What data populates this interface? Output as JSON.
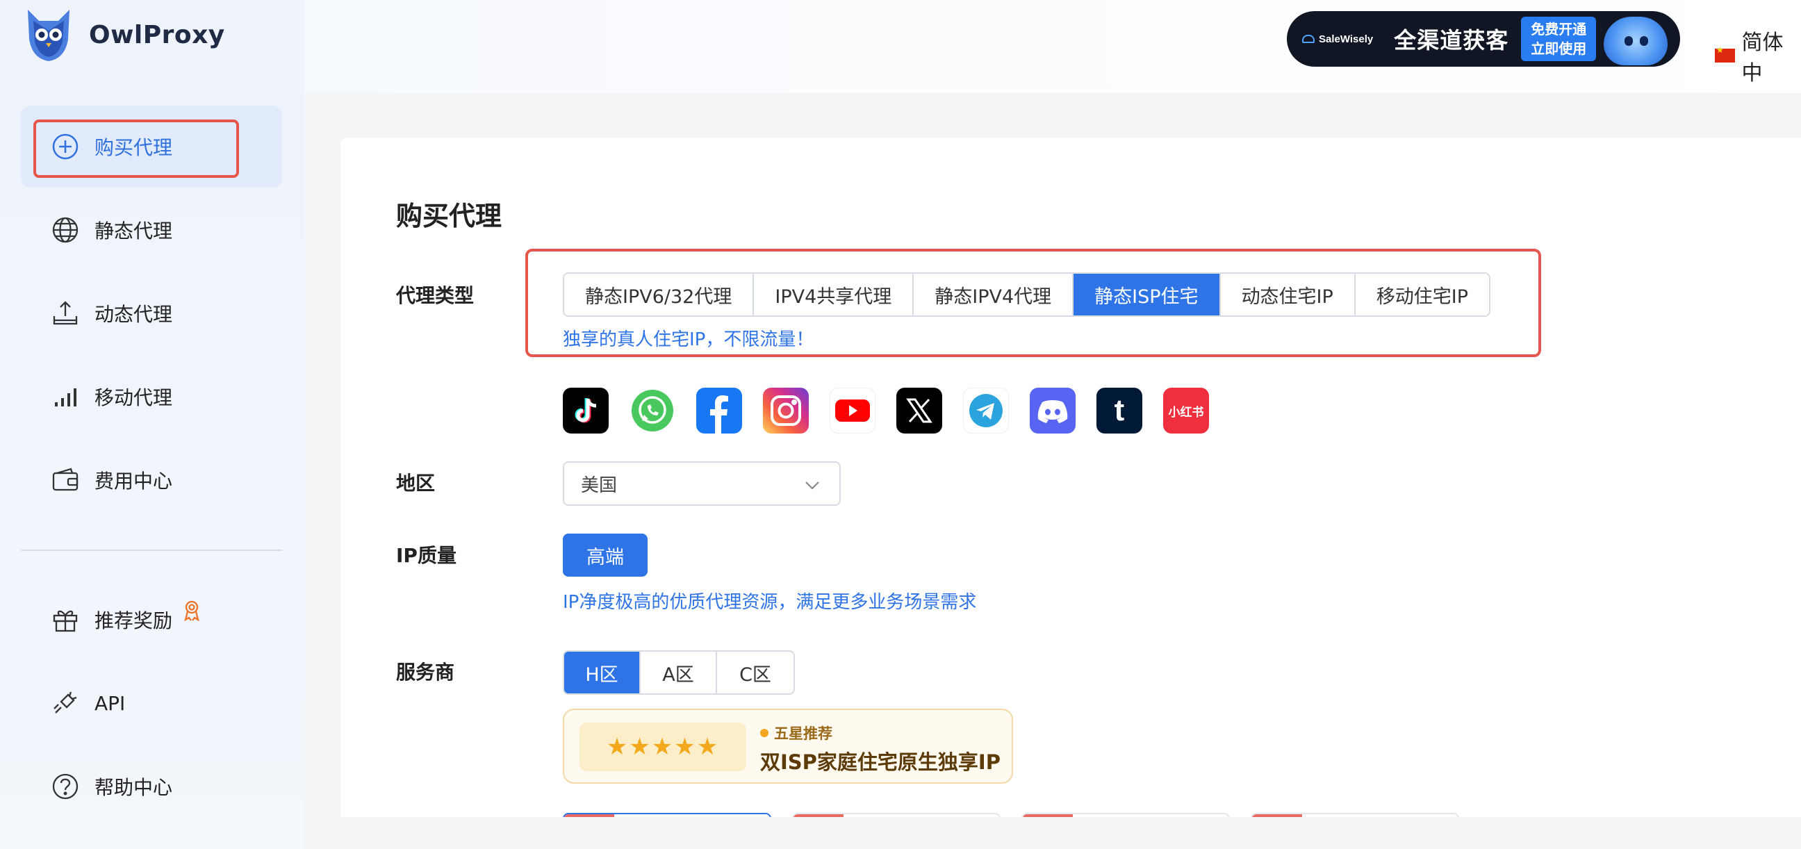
{
  "brand": {
    "name": "OwlProxy"
  },
  "sidebar": {
    "items": [
      {
        "label": "购买代理",
        "icon": "plus-circle-icon"
      },
      {
        "label": "静态代理",
        "icon": "globe-icon"
      },
      {
        "label": "动态代理",
        "icon": "upload-tray-icon"
      },
      {
        "label": "移动代理",
        "icon": "signal-bars-icon"
      },
      {
        "label": "费用中心",
        "icon": "wallet-icon"
      },
      {
        "label": "推荐奖励",
        "icon": "gift-icon"
      },
      {
        "label": "API",
        "icon": "plug-icon"
      },
      {
        "label": "帮助中心",
        "icon": "question-circle-icon"
      }
    ]
  },
  "topbar": {
    "ad": {
      "brand": "SaleWisely",
      "headline": "全渠道获客",
      "cta": "免费开通 立即使用"
    },
    "language": "简体中"
  },
  "main": {
    "title": "购买代理",
    "proxy_type": {
      "label": "代理类型",
      "tabs": [
        "静态IPV6/32代理",
        "IPV4共享代理",
        "静态IPV4代理",
        "静态ISP住宅",
        "动态住宅IP",
        "移动住宅IP"
      ],
      "selected": "静态ISP住宅",
      "hint": "独享的真人住宅IP，不限流量！"
    },
    "platforms": [
      {
        "name": "tiktok",
        "text": "♪"
      },
      {
        "name": "whatsapp",
        "text": ""
      },
      {
        "name": "facebook",
        "text": "f"
      },
      {
        "name": "instagram",
        "text": ""
      },
      {
        "name": "youtube",
        "text": ""
      },
      {
        "name": "x",
        "text": "X"
      },
      {
        "name": "telegram",
        "text": ""
      },
      {
        "name": "discord",
        "text": ""
      },
      {
        "name": "tumblr",
        "text": "t"
      },
      {
        "name": "xiaohongshu",
        "text": "小红书"
      }
    ],
    "region": {
      "label": "地区",
      "value": "美国"
    },
    "ip_quality": {
      "label": "IP质量",
      "button": "高端",
      "hint": "IP净度极高的优质代理资源，满足更多业务场景需求"
    },
    "provider": {
      "label": "服务商",
      "tabs": [
        "H区",
        "A区",
        "C区"
      ],
      "selected": "H区",
      "recommend": {
        "stars": "★★★★★",
        "tag": "五星推荐",
        "title": "双ISP家庭住宅原生独享IP"
      }
    }
  },
  "colors": {
    "accent": "#2f74e6",
    "highlight_outline": "#e5574d",
    "hint": "#2f74e6"
  }
}
